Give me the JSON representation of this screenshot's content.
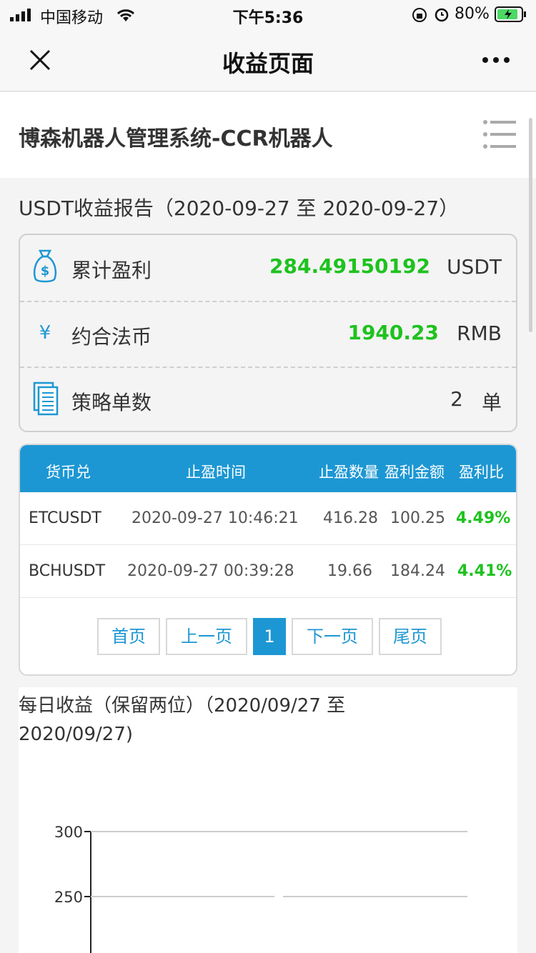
{
  "status_bar": {
    "carrier": "中国移动",
    "time": "下午5:36",
    "battery": "80%"
  },
  "nav": {
    "title": "收益页面"
  },
  "header": {
    "title": "博森机器人管理系统-CCR机器人"
  },
  "report": {
    "title": "USDT收益报告（2020-09-27 至 2020-09-27）"
  },
  "summary": [
    {
      "label": "累计盈利",
      "value": "284.49150192",
      "unit": "USDT",
      "icon": "money-bag-icon"
    },
    {
      "label": "约合法币",
      "value": "1940.23",
      "unit": "RMB",
      "icon": "yen-icon"
    },
    {
      "label": "策略单数",
      "value": "2",
      "unit": "单",
      "icon": "document-icon"
    }
  ],
  "table": {
    "headers": [
      "货币兑",
      "止盈时间",
      "止盈数量",
      "盈利金额",
      "盈利比"
    ],
    "rows": [
      [
        "ETCUSDT",
        "2020-09-27 10:46:21",
        "416.28",
        "100.25",
        "4.49%"
      ],
      [
        "BCHUSDT",
        "2020-09-27 00:39:28",
        "19.66",
        "184.24",
        "4.41%"
      ]
    ]
  },
  "pagination": {
    "first": "首页",
    "prev": "上一页",
    "current": "1",
    "next": "下一页",
    "last": "尾页"
  },
  "chart": {
    "title": "每日收益（保留两位）（2020/09/27 至 2020/09/27)"
  },
  "chart_data": {
    "type": "line",
    "title": "每日收益（保留两位）（2020/09/27 至 2020/09/27)",
    "yticks": [
      "300",
      "250"
    ],
    "grid": true
  },
  "colors": {
    "accent": "#1d97d3",
    "profit": "#1ec21e"
  }
}
